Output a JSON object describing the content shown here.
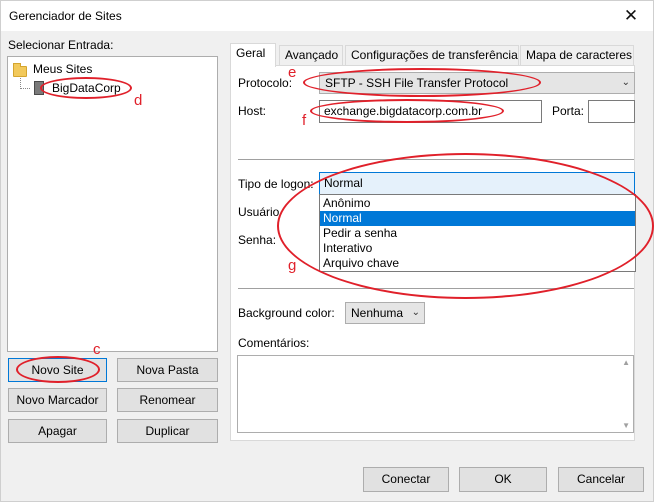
{
  "window": {
    "title": "Gerenciador de Sites"
  },
  "left": {
    "select_label": "Selecionar Entrada:",
    "tree": {
      "root": "Meus Sites",
      "child": "BigDataCorp"
    },
    "buttons": {
      "new_site": "Novo Site",
      "new_folder": "Nova Pasta",
      "new_bookmark": "Novo Marcador",
      "rename": "Renomear",
      "delete": "Apagar",
      "duplicate": "Duplicar"
    }
  },
  "tabs": [
    "Geral",
    "Avançado",
    "Configurações de transferência",
    "Mapa de caracteres"
  ],
  "general": {
    "protocol_label": "Protocolo:",
    "protocol_value": "SFTP - SSH File Transfer Protocol",
    "host_label": "Host:",
    "host_value": "exchange.bigdatacorp.com.br",
    "port_label": "Porta:",
    "port_value": "",
    "logon_label": "Tipo de logon:",
    "logon_value": "Normal",
    "logon_options": [
      "Anônimo",
      "Normal",
      "Pedir a senha",
      "Interativo",
      "Arquivo chave"
    ],
    "user_label": "Usuário",
    "password_label": "Senha:",
    "bg_color_label": "Background color:",
    "bg_color_value": "Nenhuma",
    "comments_label": "Comentários:"
  },
  "footer": {
    "connect": "Conectar",
    "ok": "OK",
    "cancel": "Cancelar"
  },
  "annotations": {
    "c": "c",
    "d": "d",
    "e": "e",
    "f": "f",
    "g": "g"
  },
  "colors": {
    "annotation": "#e0202a",
    "selection": "#0078d7"
  }
}
